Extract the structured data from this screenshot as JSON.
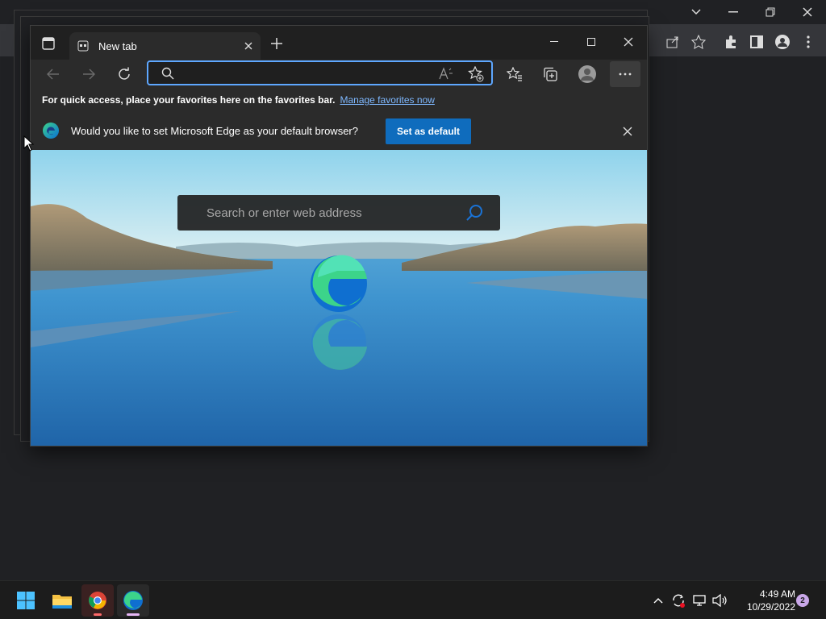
{
  "edge": {
    "tab_title": "New tab",
    "address_value": "",
    "favbar_text": "For quick access, place your favorites here on the favorites bar.",
    "favbar_link": "Manage favorites now",
    "infobar_text": "Would you like to set Microsoft Edge as your default browser?",
    "set_default_label": "Set as default",
    "search_placeholder": "Search or enter web address"
  },
  "taskbar": {
    "time": "4:49 AM",
    "date": "10/29/2022",
    "notification_count": "2",
    "apps": [
      "start-icon",
      "file-explorer-icon",
      "chrome-icon",
      "edge-icon"
    ]
  },
  "colors": {
    "accent": "#0f6cbd",
    "address_focus": "#5ea7ff",
    "link": "#7eb8ff",
    "badge": "#c9a7e8"
  }
}
